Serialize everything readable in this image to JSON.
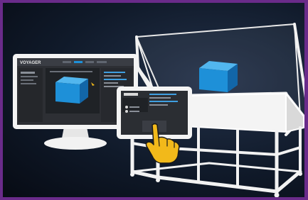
{
  "monitor": {
    "brand": "VOYAGER"
  },
  "colors": {
    "border": "#6a2b8a",
    "cube_front": "#1e90d8",
    "cube_top": "#52b6ee",
    "cube_side": "#1266a8",
    "hand": "#f2b91a",
    "frame_white": "#f4f4f4"
  },
  "icons": [
    "desktop-monitor-icon",
    "tablet-icon",
    "tap-hand-icon",
    "cube-icon",
    "greenhouse-frame-icon"
  ]
}
